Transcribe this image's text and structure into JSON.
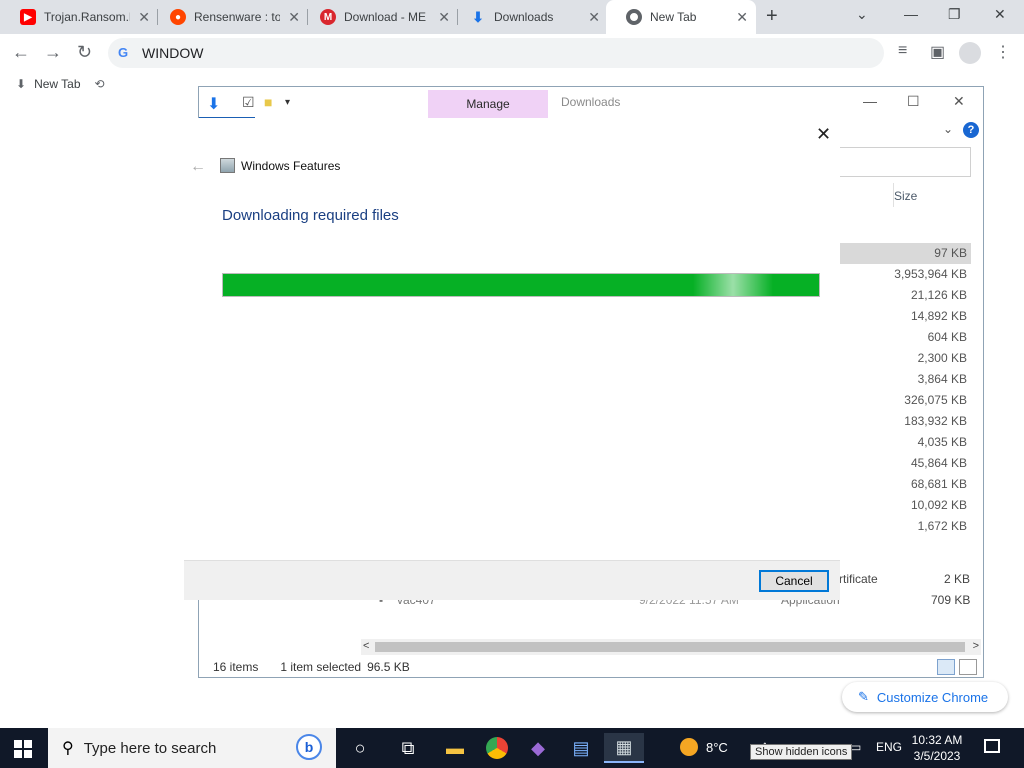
{
  "browser": {
    "tabs": [
      {
        "title": "Trojan.Ransom.M",
        "icon": "youtube-icon",
        "color": "#ff0000"
      },
      {
        "title": "Rensenware : to",
        "icon": "reddit-icon",
        "color": "#ff4500"
      },
      {
        "title": "Download - ME",
        "icon": "mega-icon",
        "color": "#d9272e"
      },
      {
        "title": "Downloads",
        "icon": "download-icon",
        "color": "#1a73e8"
      },
      {
        "title": "New Tab",
        "icon": "chrome-icon",
        "color": "#5f6368"
      }
    ],
    "omnibox_text": "WINDOW",
    "bookmarks": [
      {
        "label": "New Tab",
        "icon": "download-icon"
      }
    ],
    "customize_label": "Customize Chrome"
  },
  "explorer": {
    "manage_tab": "Manage",
    "window_title": "Downloads",
    "size_header": "Size",
    "sizes": [
      "97 KB",
      "3,953,964 KB",
      "21,126 KB",
      "14,892 KB",
      "604 KB",
      "2,300 KB",
      "3,864 KB",
      "326,075 KB",
      "183,932 KB",
      "4,035 KB",
      "45,864 KB",
      "68,681 KB",
      "10,092 KB",
      "1,672 KB"
    ],
    "partial_rows": [
      {
        "type_text": "rtificate",
        "size": "2 KB"
      },
      {
        "name": "vac407",
        "date": "9/2/2022 11:57 AM",
        "type_text": "Application",
        "size": "709 KB"
      }
    ],
    "status": {
      "items": "16 items",
      "selected": "1 item selected",
      "selected_size": "96.5 KB"
    }
  },
  "dialog": {
    "app_title": "Windows Features",
    "heading": "Downloading required files",
    "progress": 1.0,
    "cancel_label": "Cancel"
  },
  "taskbar": {
    "search_placeholder": "Type here to search",
    "weather": "8°C",
    "tooltip": "Show hidden icons",
    "language": "ENG",
    "time": "10:32 AM",
    "date": "3/5/2023"
  }
}
